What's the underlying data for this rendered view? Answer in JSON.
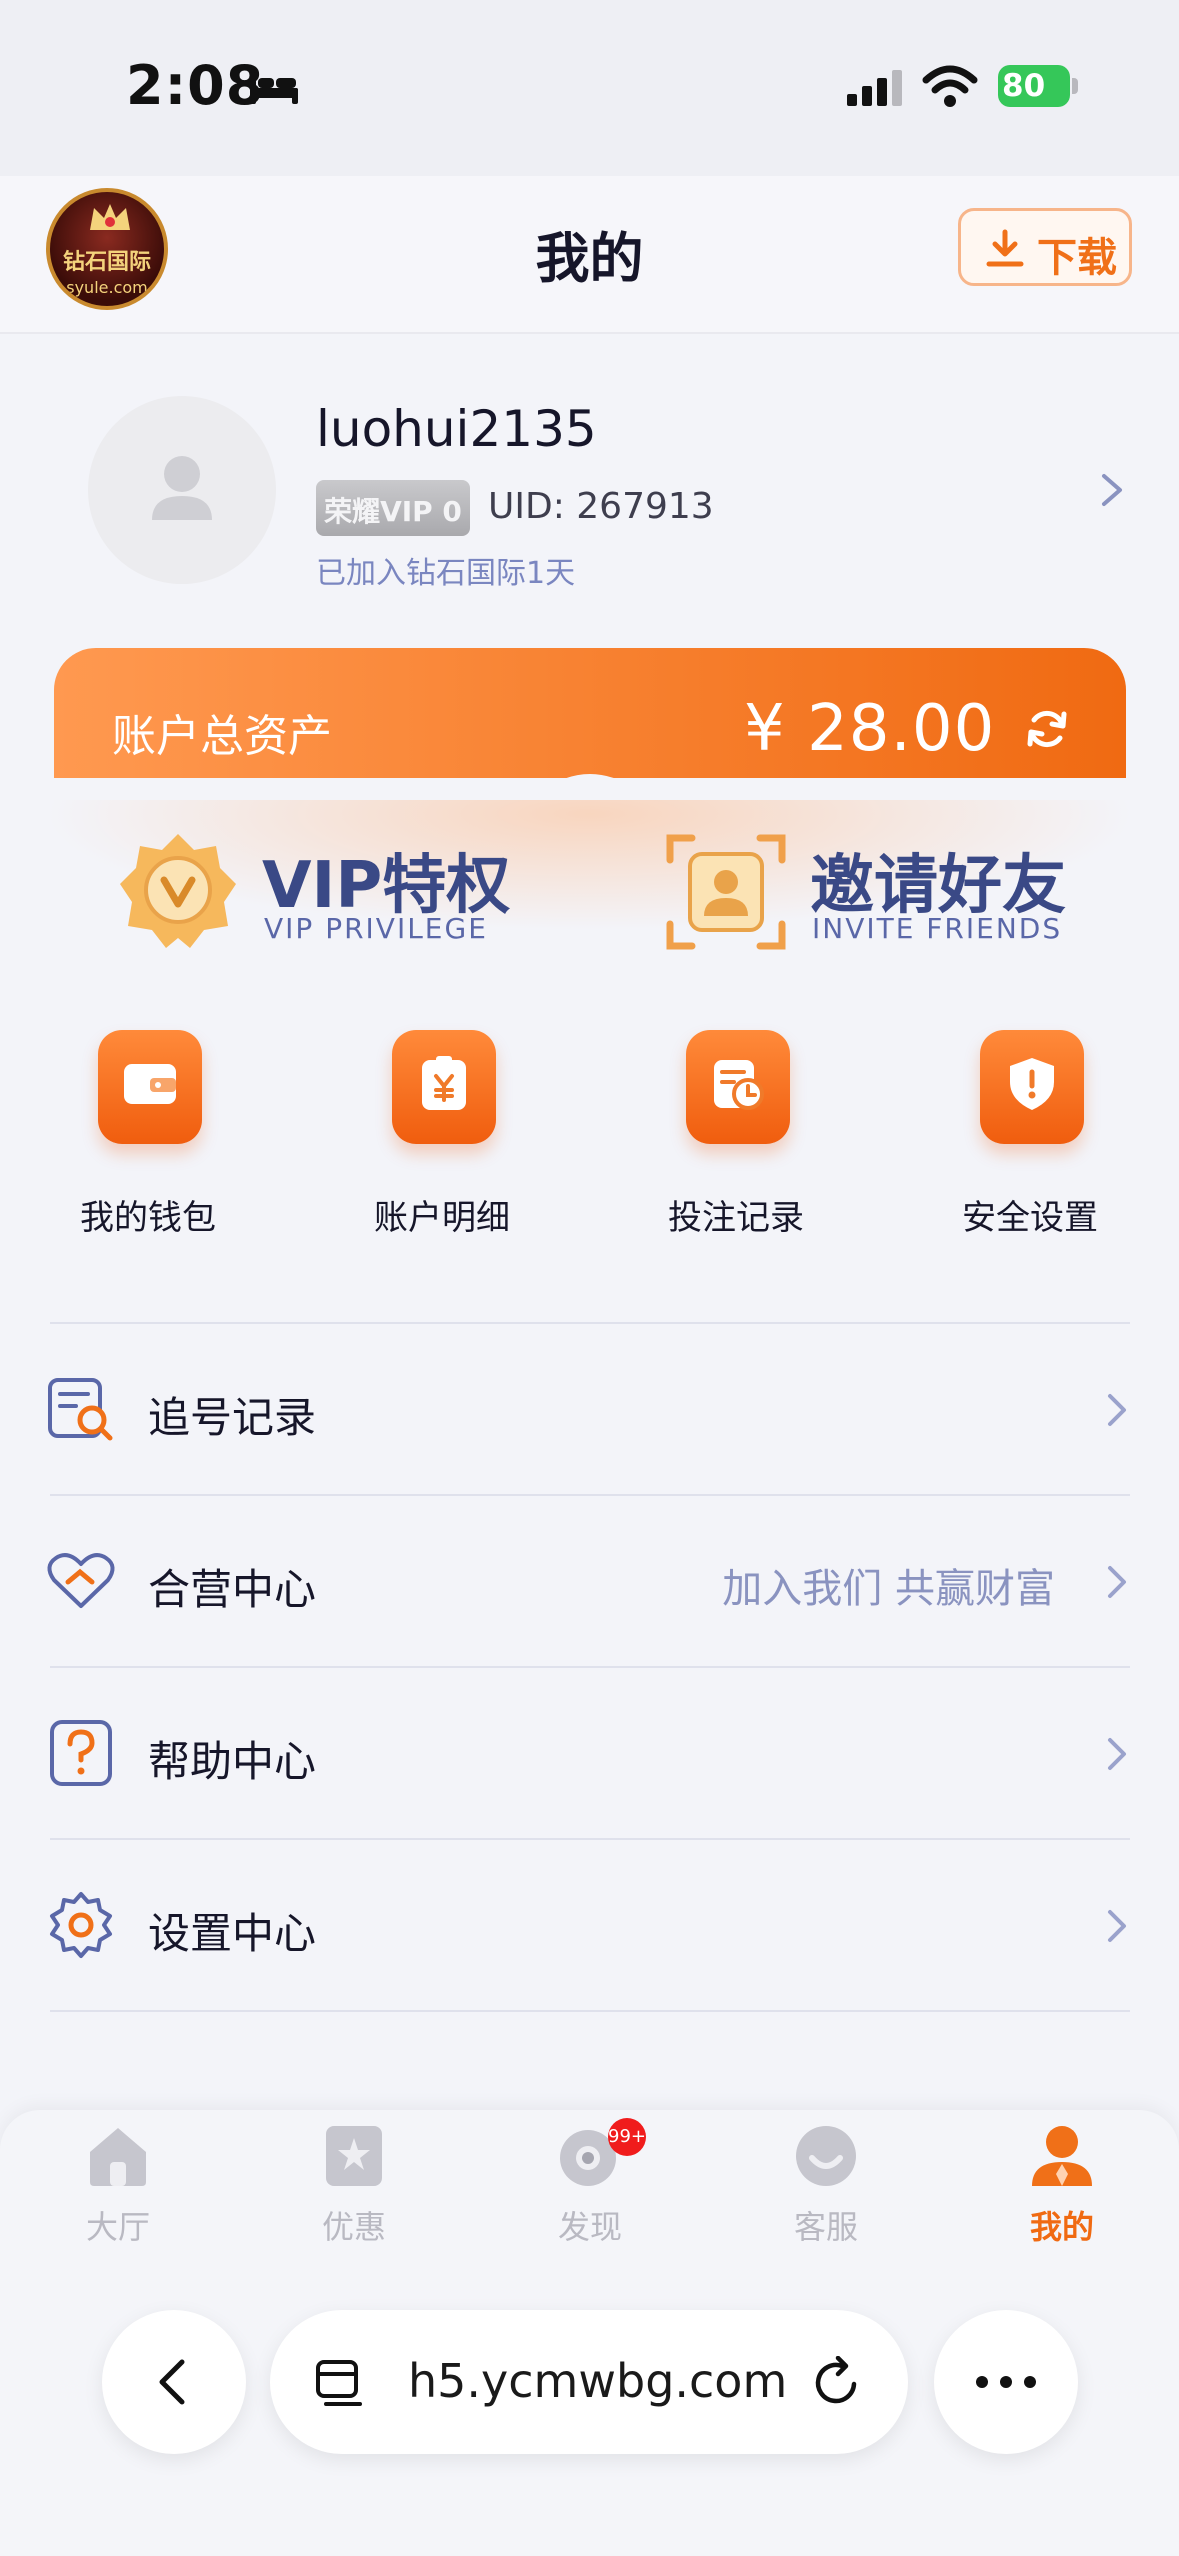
{
  "status_bar": {
    "time": "2:08",
    "battery": "80"
  },
  "header": {
    "logo_text": "钻石国际",
    "logo_sub": "syule.com",
    "title": "我的",
    "download_label": "下载"
  },
  "profile": {
    "username": "luohui2135",
    "vip_level": "荣耀VIP 0",
    "uid": "UID: 267913",
    "joined": "已加入钻石国际1天"
  },
  "assets": {
    "label": "账户总资产",
    "value": "¥ 28.00"
  },
  "features": {
    "vip": {
      "title": "VIP特权",
      "subtitle": "VIP PRIVILEGE"
    },
    "invite": {
      "title": "邀请好友",
      "subtitle": "INVITE FRIENDS"
    }
  },
  "quick_actions": [
    {
      "label": "我的钱包",
      "icon": "wallet-icon"
    },
    {
      "label": "账户明细",
      "icon": "yuan-clipboard-icon"
    },
    {
      "label": "投注记录",
      "icon": "bet-record-icon"
    },
    {
      "label": "安全设置",
      "icon": "shield-icon"
    }
  ],
  "menu": [
    {
      "label": "追号记录",
      "extra": "",
      "icon": "search-record-icon"
    },
    {
      "label": "合营中心",
      "extra": "加入我们 共赢财富",
      "icon": "handshake-heart-icon"
    },
    {
      "label": "帮助中心",
      "extra": "",
      "icon": "question-icon"
    },
    {
      "label": "设置中心",
      "extra": "",
      "icon": "gear-icon"
    }
  ],
  "bottom_nav": {
    "items": [
      {
        "label": "大厅",
        "icon": "home-icon"
      },
      {
        "label": "优惠",
        "icon": "star-icon"
      },
      {
        "label": "发现",
        "icon": "discover-icon",
        "badge": "99+"
      },
      {
        "label": "客服",
        "icon": "service-icon"
      },
      {
        "label": "我的",
        "icon": "user-icon"
      }
    ],
    "active_index": 4
  },
  "browser": {
    "url": "h5.ycmwbg.com"
  },
  "colors": {
    "accent": "#f06a12",
    "nav_text": "#3a4986",
    "inactive": "#b9b9c2"
  }
}
